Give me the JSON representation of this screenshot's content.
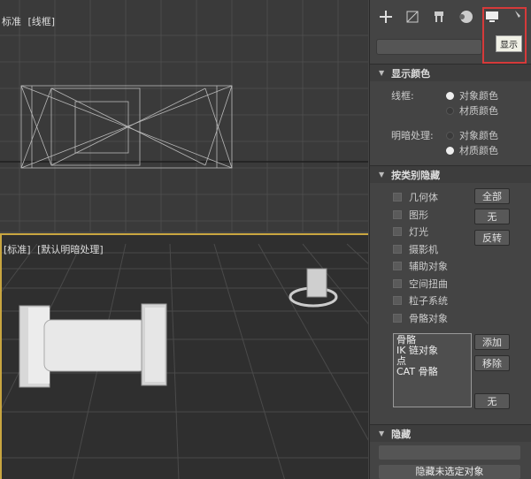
{
  "viewport_top": {
    "labels": [
      "标准",
      "[线框]"
    ]
  },
  "viewport_bottom": {
    "labels": [
      "[标准]",
      "[默认明暗处理]"
    ]
  },
  "panel": {
    "tooltip": "显示",
    "display_color": {
      "title": "显示颜色",
      "wireframe_label": "线框:",
      "shaded_label": "明暗处理:",
      "object_color": "对象颜色",
      "material_color": "材质颜色"
    },
    "hide_by_category": {
      "title": "按类别隐藏",
      "items": [
        "几何体",
        "图形",
        "灯光",
        "摄影机",
        "辅助对象",
        "空间扭曲",
        "粒子系统",
        "骨骼对象"
      ],
      "all_button": "全部",
      "none_button": "无",
      "invert_button": "反转",
      "list_items": [
        "骨骼",
        "IK 链对象",
        "点",
        "CAT 骨骼"
      ],
      "add_button": "添加",
      "remove_button": "移除",
      "none_button2": "无"
    },
    "hide_section": {
      "title": "隐藏",
      "bottom_button": "隐藏未选定对象"
    }
  },
  "colors": {
    "active_border": "#c9a640",
    "highlight": "#d63a3a"
  }
}
